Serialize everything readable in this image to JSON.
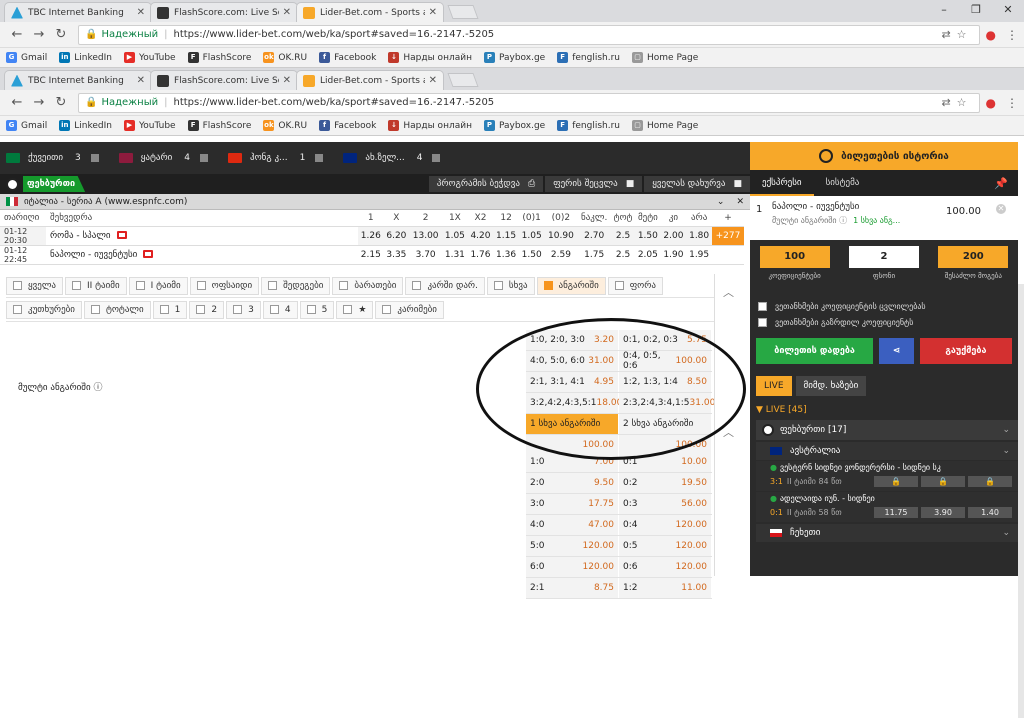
{
  "browser": {
    "tabs": [
      {
        "title": "TBC Internet Banking",
        "color": "#2a9fd6"
      },
      {
        "title": "FlashScore.com: Live Soc",
        "color": "#333333"
      },
      {
        "title": "Lider-Bet.com - Sports a",
        "color": "#f7a829"
      }
    ],
    "address": {
      "secure": "Надежный",
      "url": "https://www.lider-bet.com/web/ka/sport#saved=16.-2147.-5205"
    },
    "bookmarks": [
      {
        "label": "Gmail",
        "icon": "G",
        "color": "#4285f4"
      },
      {
        "label": "LinkedIn",
        "icon": "in",
        "color": "#0077b5"
      },
      {
        "label": "YouTube",
        "icon": "▶",
        "color": "#e52d27"
      },
      {
        "label": "FlashScore",
        "icon": "F",
        "color": "#333333"
      },
      {
        "label": "OK.RU",
        "icon": "ok",
        "color": "#f7931e"
      },
      {
        "label": "Facebook",
        "icon": "f",
        "color": "#3b5998"
      },
      {
        "label": "Нарды онлайн",
        "icon": "↓",
        "color": "#c0392b"
      },
      {
        "label": "Paybox.ge",
        "icon": "P",
        "color": "#2980b9"
      },
      {
        "label": "fenglish.ru",
        "icon": "F",
        "color": "#2c6fb5"
      },
      {
        "label": "Home Page",
        "icon": "▢",
        "color": "#999999"
      }
    ]
  },
  "flags": [
    {
      "name": "ქუვეითი",
      "count": "3",
      "color": "#007a3d"
    },
    {
      "name": "ყატარი",
      "count": "4",
      "color": "#8d1b3d"
    },
    {
      "name": "ჰონგ კ...",
      "count": "1",
      "color": "#de2910"
    },
    {
      "name": "ახ.ზელ...",
      "count": "4",
      "color": "#00247d"
    }
  ],
  "sport": {
    "title": "ფეხბურთი",
    "opt1": "პროგრამის ბეჭდვა",
    "opt2": "ფერის შეცვლა",
    "opt3": "ყველას დახურვა"
  },
  "league": {
    "title": "იტალია - სერია A (www.espnfc.com)"
  },
  "table": {
    "headers": [
      "თარიღი",
      "შეხვედრა",
      "1",
      "X",
      "2",
      "1X",
      "X2",
      "12",
      "(0)1",
      "(0)2",
      "ნაკლ.",
      "ტოტ",
      "მეტი",
      "კი",
      "არა"
    ],
    "rows": [
      {
        "time": "01-12 20:30",
        "name": "რომა - სპალი",
        "odds": [
          "1.26",
          "6.20",
          "13.00",
          "1.05",
          "4.20",
          "1.15",
          "1.05",
          "10.90",
          "2.70",
          "2.5",
          "1.50",
          "2.00",
          "1.80"
        ],
        "more": "+277"
      },
      {
        "time": "01-12 22:45",
        "name": "ნაპოლი - იუვენტუსი",
        "odds": [
          "2.15",
          "3.35",
          "3.70",
          "1.31",
          "1.76",
          "1.36",
          "1.50",
          "2.59",
          "1.75",
          "2.5",
          "2.05",
          "1.90",
          "1.95"
        ],
        "more": "+323"
      }
    ]
  },
  "filters": {
    "row1": [
      "ყველა",
      "II ტაიმი",
      "I ტაიმი",
      "ოფსაიდი",
      "შედეგები",
      "ბარათები",
      "კარში დარ.",
      "სხვა",
      "ანგარიში",
      "ფორა"
    ],
    "row1_active": 8,
    "row2": [
      "კუთხურები",
      "ტოტალი",
      "1",
      "2",
      "3",
      "4",
      "5",
      "★",
      "კარიმები"
    ]
  },
  "market_label": "მულტი ანგარიში ⓘ",
  "multi": {
    "rows": [
      [
        {
          "l": "1:0, 2:0, 3:0",
          "v": "3.20"
        },
        {
          "l": "0:1, 0:2, 0:3",
          "v": "5.75"
        }
      ],
      [
        {
          "l": "4:0, 5:0, 6:0",
          "v": "31.00"
        },
        {
          "l": "0:4, 0:5, 0:6",
          "v": "100.00"
        }
      ],
      [
        {
          "l": "2:1, 3:1, 4:1",
          "v": "4.95"
        },
        {
          "l": "1:2, 1:3, 1:4",
          "v": "8.50"
        }
      ],
      [
        {
          "l": "3:2,4:2,4:3,5:1",
          "v": "18.00"
        },
        {
          "l": "2:3,2:4,3:4,1:5",
          "v": "31.00"
        }
      ],
      [
        {
          "l": "1 სხვა ანგარიში",
          "v": ""
        },
        {
          "l": "2 სხვა ანგარიში",
          "v": ""
        }
      ],
      [
        {
          "l": "",
          "v": "100.00"
        },
        {
          "l": "",
          "v": "100.00"
        }
      ]
    ]
  },
  "correct": {
    "rows": [
      [
        {
          "l": "1:0",
          "v": "7.00"
        },
        {
          "l": "0:1",
          "v": "10.00"
        }
      ],
      [
        {
          "l": "2:0",
          "v": "9.50"
        },
        {
          "l": "0:2",
          "v": "19.50"
        }
      ],
      [
        {
          "l": "3:0",
          "v": "17.75"
        },
        {
          "l": "0:3",
          "v": "56.00"
        }
      ],
      [
        {
          "l": "4:0",
          "v": "47.00"
        },
        {
          "l": "0:4",
          "v": "120.00"
        }
      ],
      [
        {
          "l": "5:0",
          "v": "120.00"
        },
        {
          "l": "0:5",
          "v": "120.00"
        }
      ],
      [
        {
          "l": "6:0",
          "v": "120.00"
        },
        {
          "l": "0:6",
          "v": "120.00"
        }
      ],
      [
        {
          "l": "2:1",
          "v": "8.75"
        },
        {
          "l": "1:2",
          "v": "11.00"
        }
      ]
    ]
  },
  "betslip": {
    "history": "ბილეთების ისტორია",
    "tab1": "ექსპრესი",
    "tab2": "სისტემა",
    "num": "1",
    "match": "ნაპოლი - იუვენტუსი",
    "sub": "მულტი ანგარიში ⓘ",
    "sub2": "1 სხვა ანგ...",
    "odd": "100.00",
    "stake1": "100",
    "stake1_label": "კოეფიციენტები",
    "stake2": "2",
    "stake2_label": "ფსონი",
    "stake3": "200",
    "stake3_label": "შესაძლო მოგება",
    "chk1": "ვეთანხმები კოეფიციენტის ცვლილებას",
    "chk2": "ვეთანხმები გაზრდილ კოეფიციენტს",
    "place": "ბილეთის დადება",
    "clear": "გაუქმება",
    "live_tab": "LIVE",
    "sched_tab": "მიმდ. ხაზები",
    "live_hdr": "▼ LIVE [45]",
    "sport_row": "ფეხბურთი [17]",
    "country1": "ავსტრალია",
    "m1_name": "ვესტერნ სიდნეი ვონდერერსი - სიდნეი სკ",
    "m1_score": "3:1",
    "m1_time": "II ტაიმი 84 წთ",
    "m2_name": "ადელაიდა იუნ. - სიდნეი",
    "m2_score": "0:1",
    "m2_time": "II ტაიმი 58 წთ",
    "m2_o1": "11.75",
    "m2_o2": "3.90",
    "m2_o3": "1.40",
    "country2": "ჩეხეთი"
  }
}
